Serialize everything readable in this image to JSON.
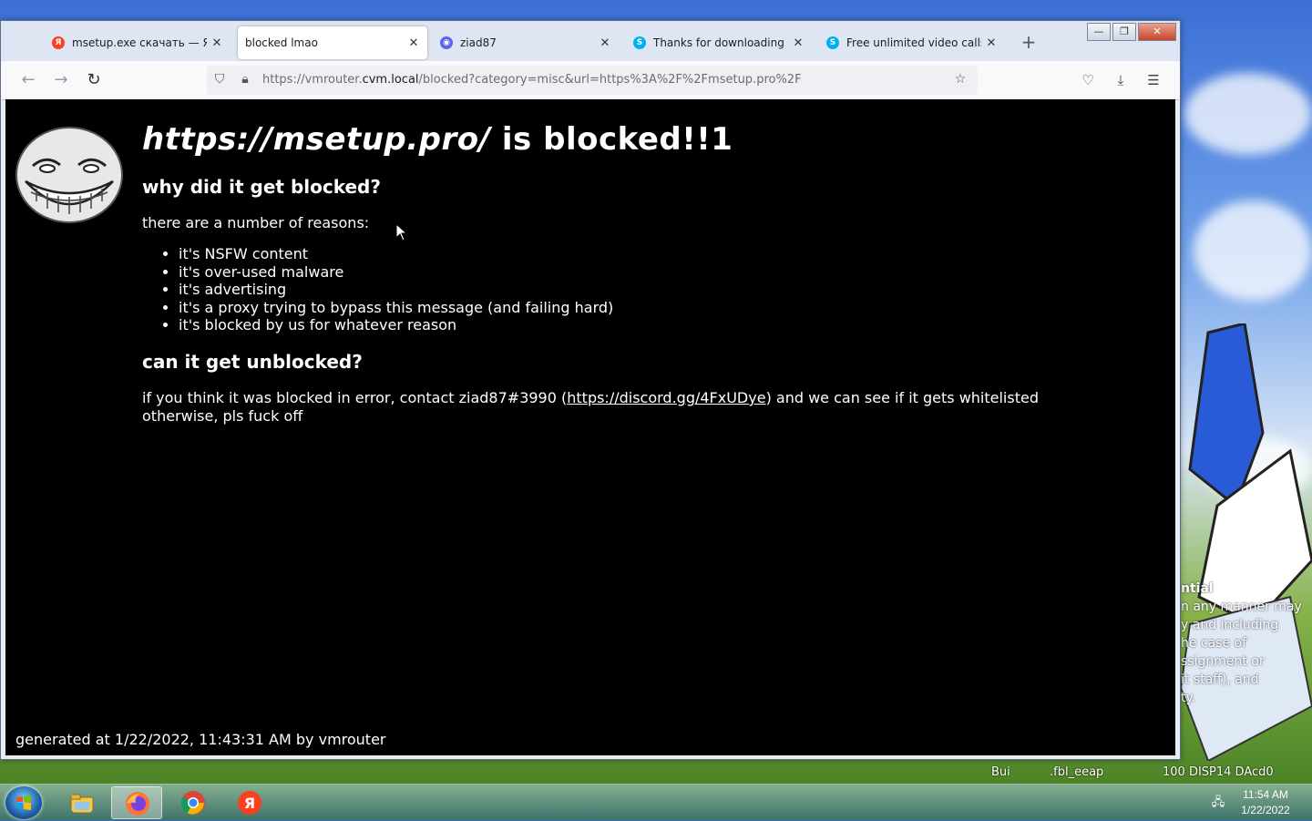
{
  "browser": {
    "tabs": [
      {
        "label": "msetup.exe скачать — Яндекс",
        "favicon": "yandex-icon",
        "color": "#fc3f1d",
        "active": false
      },
      {
        "label": "blocked lmao",
        "favicon": "",
        "active": true
      },
      {
        "label": "ziad87",
        "favicon": "discord-icon",
        "color": "#5865f2",
        "active": false
      },
      {
        "label": "Thanks for downloading Skype",
        "favicon": "skype-icon",
        "color": "#00aff0",
        "active": false
      },
      {
        "label": "Free unlimited video calls & chats",
        "favicon": "skype-icon",
        "color": "#00aff0",
        "active": false
      }
    ],
    "url": {
      "prefix": "https://vmrouter.",
      "host": "cvm.local",
      "path": "/blocked?category=misc&url=https%3A%2F%2Fmsetup.pro%2F"
    }
  },
  "page": {
    "title_url": "https://msetup.pro/",
    "title_suffix": " is blocked!!1",
    "why_heading": "why did it get blocked?",
    "reasons_intro": "there are a number of reasons:",
    "reasons": [
      "it's NSFW content",
      "it's over-used malware",
      "it's advertising",
      "it's a proxy trying to bypass this message (and failing hard)",
      "it's blocked by us for whatever reason"
    ],
    "unblock_heading": "can it get unblocked?",
    "contact_before": "if you think it was blocked in error, contact ziad87#3990 (",
    "contact_link": "https://discord.gg/4FxUDye",
    "contact_after": ") and we can see if it gets whitelisted",
    "contact_line2": "otherwise, pls fuck off",
    "footer": "generated at 1/22/2022, 11:43:31 AM by vmrouter"
  },
  "desktop": {
    "notice_lines": [
      "ntial",
      "n any manner may",
      "y and including",
      "he case of",
      "ssignment or",
      "it staff), and",
      "ty."
    ],
    "bottom_text_left": "Bui",
    "bottom_text_mid": ".fbl_eeap",
    "bottom_text_right": "100   DISP14 DAcd0"
  },
  "taskbar": {
    "time": "11:54 AM",
    "date": "1/22/2022"
  }
}
